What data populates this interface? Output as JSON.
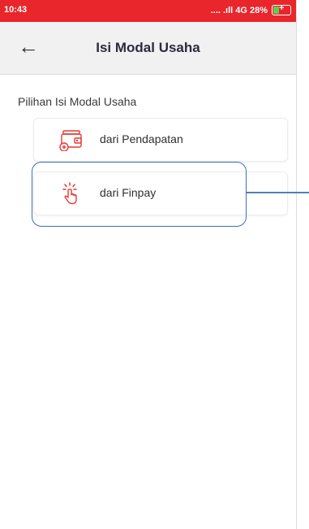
{
  "status_bar": {
    "time": "10:43",
    "network": ".... .ıll 4G",
    "battery_percent": "28%"
  },
  "header": {
    "title": "Isi Modal Usaha",
    "back_icon": "arrow-left-icon"
  },
  "section": {
    "label": "Pilihan Isi Modal Usaha"
  },
  "options": [
    {
      "label": "dari Pendapatan",
      "icon": "wallet-plus-icon"
    },
    {
      "label": "dari Finpay",
      "icon": "tap-hand-icon"
    }
  ],
  "colors": {
    "status_bar": "#e8262b",
    "accent_red": "#e53935",
    "annotation_blue": "#3d6fb6"
  }
}
